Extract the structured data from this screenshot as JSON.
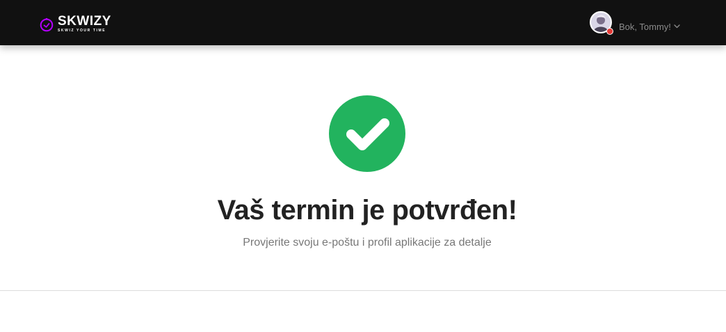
{
  "header": {
    "logo_name": "SKWIZY",
    "logo_tagline": "SKWIZ YOUR TIME",
    "logo_icon": "clock-icon",
    "user_greeting": "Bok, Tommy!",
    "user_menu_icon": "chevron-down-icon",
    "user_status": "status-dot-red"
  },
  "main": {
    "status_icon": "checkmark-circle-icon",
    "title": "Vaš termin je potvrđen!",
    "subtitle": "Provjerite svoju e-poštu i profil aplikacije za detalje"
  },
  "colors": {
    "topbar": "#111111",
    "logo_accent": "#b400ff",
    "success_green": "#22b35e",
    "status_dot": "#e53935",
    "title_text": "#222222",
    "subtitle_text": "#777777"
  }
}
